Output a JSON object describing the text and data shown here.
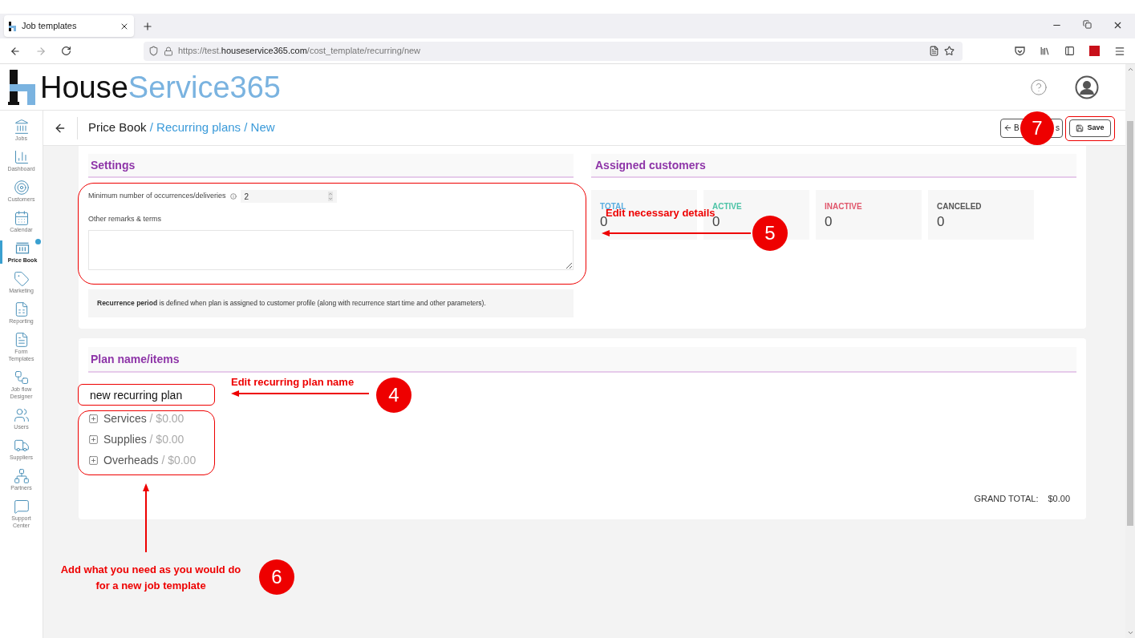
{
  "browser": {
    "tab_title": "Job templates",
    "url_prefix": "https://test.",
    "url_domain": "houseservice365.com",
    "url_path": "/cost_template/recurring/new"
  },
  "logo": {
    "dark": "House",
    "light": "Service365"
  },
  "sidebar": [
    {
      "label": "Jobs",
      "selected": false
    },
    {
      "label": "Dashboard",
      "selected": false
    },
    {
      "label": "Customers",
      "selected": false
    },
    {
      "label": "Calendar",
      "selected": false
    },
    {
      "label": "Price Book",
      "selected": true
    },
    {
      "label": "Marketing",
      "selected": false
    },
    {
      "label": "Reporting",
      "selected": false
    },
    {
      "label": "Form Templates",
      "selected": false
    },
    {
      "label": "Job flow Designer",
      "selected": false
    },
    {
      "label": "Users",
      "selected": false
    },
    {
      "label": "Suppliers",
      "selected": false
    },
    {
      "label": "Partners",
      "selected": false
    },
    {
      "label": "Support Center",
      "selected": false
    }
  ],
  "breadcrumb": {
    "root": "Price Book",
    "trail": "/ Recurring plans / New"
  },
  "toolbar": {
    "back_visible": [
      "B",
      "s"
    ],
    "save": "Save"
  },
  "settings": {
    "title": "Settings",
    "min_label": "Minimum number of occurrences/deliveries",
    "min_value": "2",
    "remarks_label": "Other remarks & terms",
    "note": "**Recurrence period** is defined when plan is assigned to customer profile (along with recurrence start time and other parameters)."
  },
  "assigned": {
    "title": "Assigned customers",
    "stats": [
      {
        "label": "TOTAL",
        "value": "0",
        "color": "#5aaee0"
      },
      {
        "label": "ACTIVE",
        "value": "0",
        "color": "#4cc3a6"
      },
      {
        "label": "INACTIVE",
        "value": "0",
        "color": "#e0566b"
      },
      {
        "label": "CANCELED",
        "value": "0",
        "color": "#555555"
      }
    ]
  },
  "plan": {
    "title": "Plan name/items",
    "name": "new recurring plan",
    "groups": [
      {
        "name": "Services",
        "amount": "/ $0.00"
      },
      {
        "name": "Supplies",
        "amount": "/ $0.00"
      },
      {
        "name": "Overheads",
        "amount": "/ $0.00"
      }
    ],
    "grand_total_label": "GRAND TOTAL:",
    "grand_total": "$0.00"
  },
  "annotations": [
    {
      "number": "5",
      "text": "Edit necessary details"
    },
    {
      "number": "4",
      "text": "Edit recurring plan name"
    },
    {
      "number": "6",
      "text": "Add what you need as you would do for a new job template"
    },
    {
      "number": "7"
    }
  ]
}
